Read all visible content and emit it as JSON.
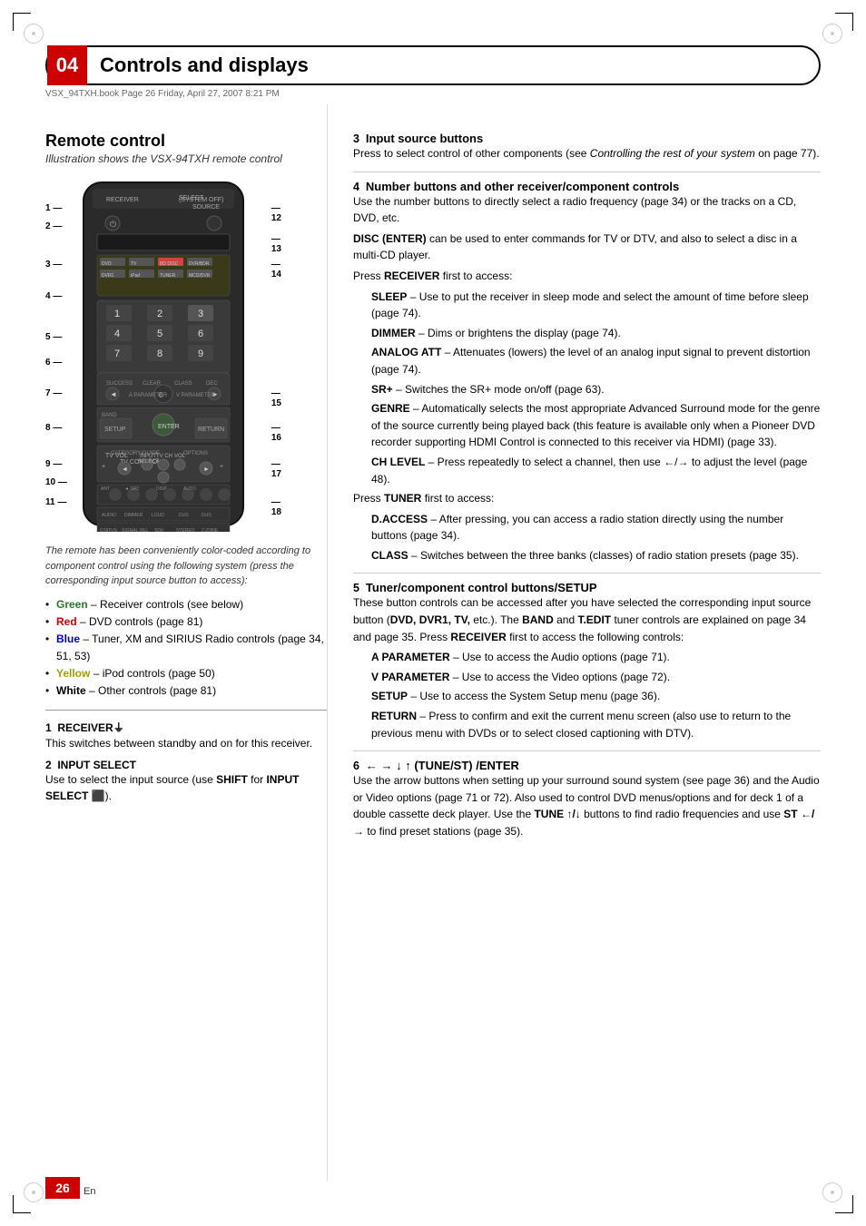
{
  "page": {
    "chapter_num": "04",
    "title": "Controls and displays",
    "file_info": "VSX_94TXH.book  Page 26  Friday, April 27, 2007  8:21 PM",
    "page_number": "26",
    "page_lang": "En"
  },
  "remote_section": {
    "title": "Remote control",
    "subtitle": "Illustration shows the VSX-94TXH remote control",
    "color_note": "The remote has been conveniently color-coded according to component control using the following system (press the corresponding input source button to access):",
    "colors": [
      {
        "color": "Green",
        "desc": "– Receiver controls (see below)"
      },
      {
        "color": "Red",
        "desc": "– DVD controls (page 81)"
      },
      {
        "color": "Blue",
        "desc": "– Tuner, XM and SIRIUS Radio controls (page 34, 51, 53)"
      },
      {
        "color": "Yellow",
        "desc": "– iPod controls (page 50)"
      },
      {
        "color": "White",
        "desc": "– Other controls (page 81)"
      }
    ]
  },
  "numbered_items_left": [
    {
      "num": "1",
      "heading": "RECEIVER",
      "body": "This switches between standby and on for this receiver."
    },
    {
      "num": "2",
      "heading": "INPUT SELECT",
      "body": "Use to select the input source (use SHIFT for INPUT SELECT)."
    }
  ],
  "numbered_items_right": [
    {
      "num": "3",
      "heading": "Input source buttons",
      "body": "Press to select control of other components (see Controlling the rest of your system on page 77)."
    },
    {
      "num": "4",
      "heading": "Number buttons and other receiver/component controls",
      "body": "Use the number buttons to directly select a radio frequency (page 34) or the tracks on a CD, DVD, etc.",
      "sub_items": [
        {
          "term": "DISC (ENTER)",
          "desc": " can be used to enter commands for TV or DTV, and also to select a disc in a multi-CD player."
        },
        {
          "intro": "Press RECEIVER first to access:"
        },
        {
          "term": "SLEEP",
          "desc": " – Use to put the receiver in sleep mode and select the amount of time before sleep (page 74)."
        },
        {
          "term": "DIMMER",
          "desc": " – Dims or brightens the display (page 74)."
        },
        {
          "term": "ANALOG ATT",
          "desc": " – Attenuates (lowers) the level of an analog input signal to prevent distortion (page 74)."
        },
        {
          "term": "SR+",
          "desc": " – Switches the SR+ mode on/off (page 63)."
        },
        {
          "term": "GENRE",
          "desc": " – Automatically selects the most appropriate Advanced Surround mode for the genre of the source currently being played back (this feature is available only when a Pioneer DVD recorder supporting HDMI Control is connected to this receiver via HDMI) (page 33)."
        },
        {
          "term": "CH LEVEL",
          "desc": " – Press repeatedly to select a channel, then use ←/→ to adjust the level (page 48)."
        },
        {
          "intro": "Press TUNER first to access:"
        },
        {
          "term": "D.ACCESS",
          "desc": " – After pressing, you can access a radio station directly using the number buttons (page 34)."
        },
        {
          "term": "CLASS",
          "desc": " – Switches between the three banks (classes) of radio station presets (page 35)."
        }
      ]
    },
    {
      "num": "5",
      "heading": "Tuner/component control buttons/SETUP",
      "body": "These button controls can be accessed after you have selected the corresponding input source button (DVD, DVR1, TV, etc.). The BAND and T.EDIT tuner controls are explained on page 34 and page 35. Press RECEIVER first to access the following controls:",
      "sub_items": [
        {
          "term": "A PARAMETER",
          "desc": " – Use to access the Audio options (page 71)."
        },
        {
          "term": "V PARAMETER",
          "desc": " – Use to access the Video options (page 72)."
        },
        {
          "term": "SETUP",
          "desc": " – Use to access the System Setup menu (page 36)."
        },
        {
          "term": "RETURN",
          "desc": " – Press to confirm and exit the current menu screen (also use to return to the previous menu with DVDs or to select closed captioning with DTV)."
        }
      ]
    },
    {
      "num": "6",
      "heading": "← → ↓ ↑ (TUNE/ST) /ENTER",
      "body": "Use the arrow buttons when setting up your surround sound system (see page 36) and the Audio or Video options (page 71 or 72). Also used to control DVD menus/options and for deck 1 of a double cassette deck player. Use the TUNE ↑/↓ buttons to find radio frequencies and use ST ←/→ to find preset stations (page 35)."
    }
  ],
  "remote_labels": {
    "left": [
      "1",
      "2",
      "3",
      "4",
      "5",
      "6",
      "7",
      "8",
      "9",
      "10",
      "11"
    ],
    "right": [
      "12",
      "13",
      "14",
      "15",
      "16",
      "17",
      "18"
    ]
  }
}
